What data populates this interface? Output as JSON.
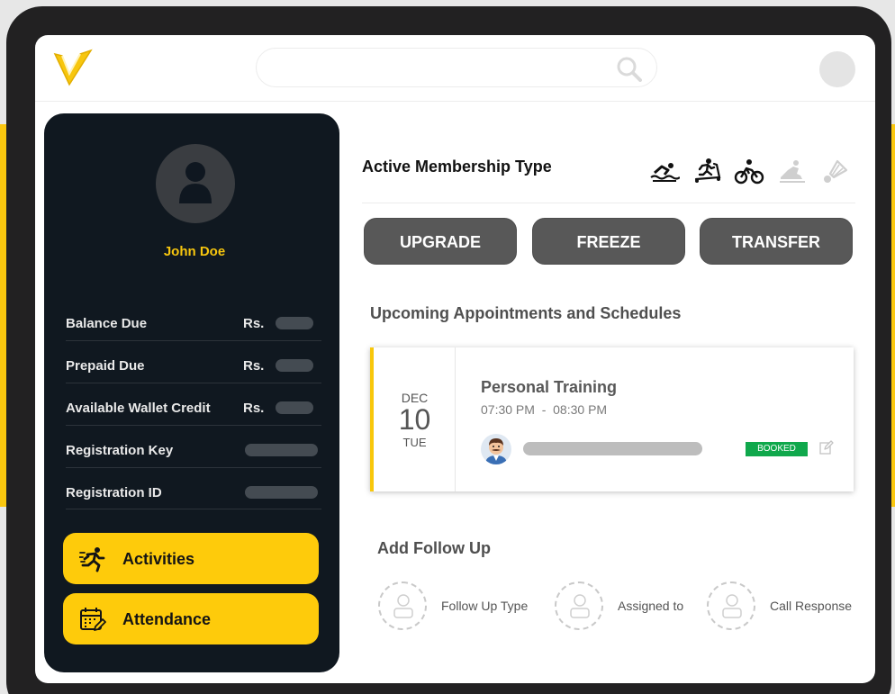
{
  "header": {
    "search_placeholder": ""
  },
  "profile": {
    "name": "John Doe"
  },
  "account": {
    "rows": [
      {
        "label": "Balance Due",
        "currency": "Rs."
      },
      {
        "label": "Prepaid Due",
        "currency": "Rs."
      },
      {
        "label": "Available Wallet Credit",
        "currency": "Rs."
      },
      {
        "label": "Registration Key",
        "currency": ""
      },
      {
        "label": "Registration ID",
        "currency": ""
      }
    ]
  },
  "sidebar": {
    "activities_label": "Activities",
    "attendance_label": "Attendance"
  },
  "membership": {
    "title": "Active Membership Type",
    "icons": [
      "swimming-icon",
      "treadmill-icon",
      "cycling-icon",
      "skating-icon",
      "badminton-icon"
    ]
  },
  "actions": {
    "upgrade": "UPGRADE",
    "freeze": "FREEZE",
    "transfer": "TRANSFER"
  },
  "appointments": {
    "title": "Upcoming Appointments and Schedules",
    "items": [
      {
        "month": "DEC",
        "day": "10",
        "weekday": "TUE",
        "title": "Personal Training",
        "time": "07:30 PM  -  08:30 PM",
        "status": "BOOKED"
      }
    ]
  },
  "followup": {
    "title": "Add Follow Up",
    "items": [
      "Follow Up Type",
      "Assigned to",
      "Call Response"
    ]
  },
  "colors": {
    "accent": "#fecb0b",
    "sidebar_bg": "#101820",
    "button_bg": "#585858",
    "booked": "#10a84c"
  }
}
